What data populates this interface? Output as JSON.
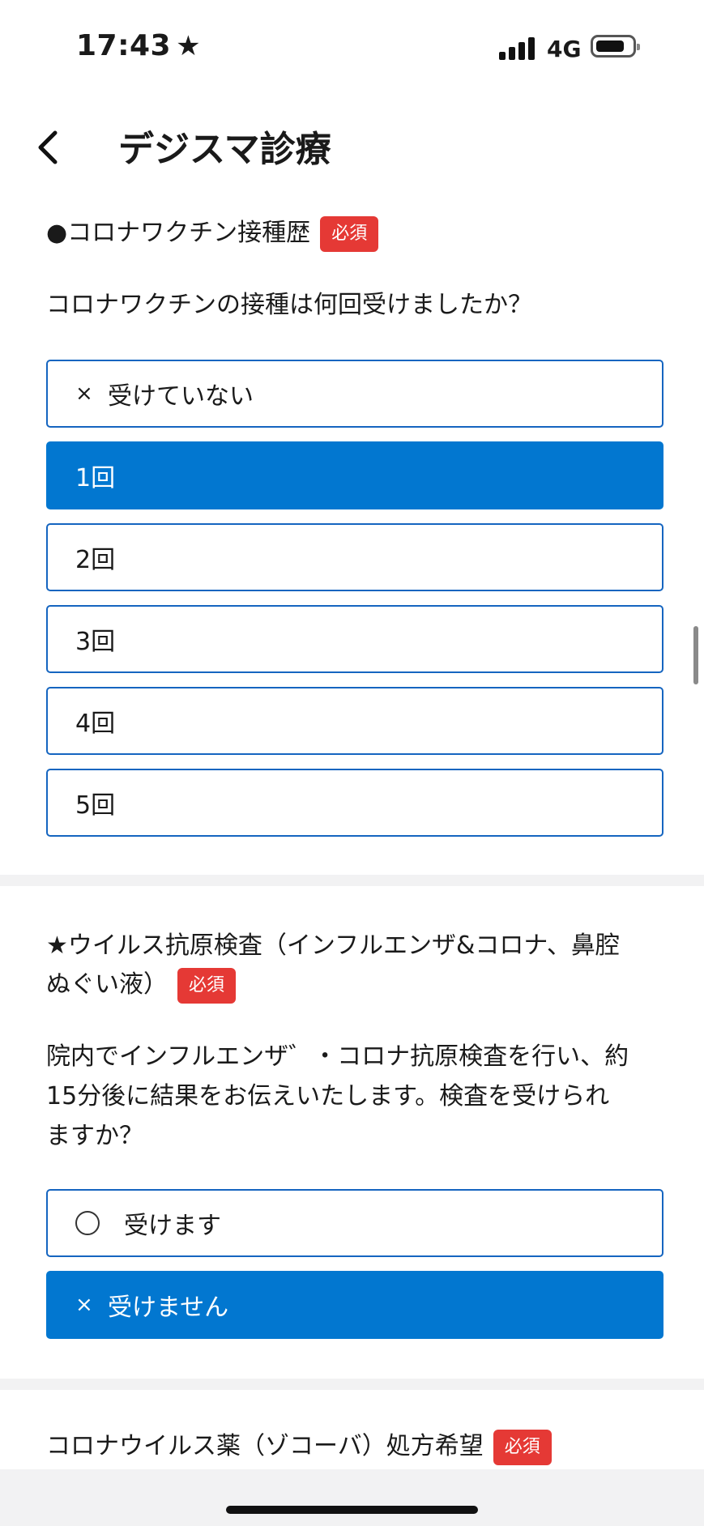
{
  "status_bar": {
    "time": "17:43",
    "time_icon": "star-icon",
    "network": "4G"
  },
  "nav": {
    "title": "デジスマ診療",
    "back_icon": "chevron-left-icon"
  },
  "q1": {
    "title": "●コロナワクチン接種歴",
    "badge": "必須",
    "question": "コロナワクチンの接種は何回受けましたか？",
    "options": [
      {
        "mark": "×",
        "label": "受けていない",
        "selected": false
      },
      {
        "label": "1回",
        "selected": true
      },
      {
        "label": "2回",
        "selected": false
      },
      {
        "label": "3回",
        "selected": false
      },
      {
        "label": "4回",
        "selected": false
      },
      {
        "label": "5回",
        "selected": false
      }
    ]
  },
  "q2": {
    "title_line1": "★ウイルス抗原検査（インフルエンザ&コロナ、鼻腔",
    "title_line2": "ぬぐい液）",
    "badge": "必須",
    "question_lines": [
      "院内でインフルエンザ゛・コロナ抗原検査を行い、約",
      "15分後に結果をお伝えいたします。検査を受けられ",
      "ますか？"
    ],
    "options": [
      {
        "mark": "◯",
        "label": "受けます",
        "selected": false
      },
      {
        "mark": "×",
        "label": "受けません",
        "selected": true
      }
    ]
  },
  "q3": {
    "title": "コロナウイルス薬（ゾコーバ）処方希望",
    "badge": "必須"
  },
  "colors": {
    "accent": "#0277d0",
    "border": "#1565c0",
    "badge": "#e53935",
    "separator": "#f2f2f3"
  }
}
